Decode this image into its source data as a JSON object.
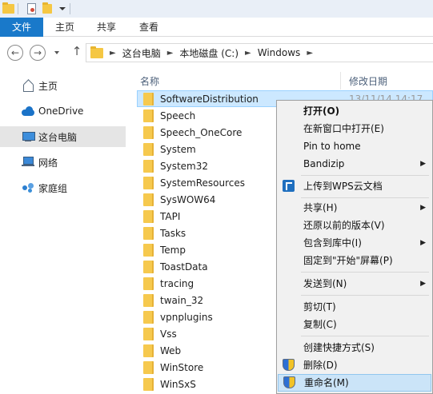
{
  "ribbon": {
    "tabs": [
      "文件",
      "主页",
      "共享",
      "查看"
    ]
  },
  "address": {
    "crumbs": [
      "这台电脑",
      "本地磁盘 (C:)",
      "Windows"
    ]
  },
  "nav": {
    "items": [
      {
        "label": "主页",
        "icon": "home-icon"
      },
      {
        "label": "OneDrive",
        "icon": "onedrive-icon"
      },
      {
        "label": "这台电脑",
        "icon": "this-pc-icon"
      },
      {
        "label": "网络",
        "icon": "network-icon"
      },
      {
        "label": "家庭组",
        "icon": "homegroup-icon"
      }
    ]
  },
  "columns": {
    "name": "名称",
    "date": "修改日期"
  },
  "files": [
    {
      "name": "SoftwareDistribution",
      "date": "13/11/14 14:17"
    },
    {
      "name": "Speech"
    },
    {
      "name": "Speech_OneCore"
    },
    {
      "name": "System"
    },
    {
      "name": "System32"
    },
    {
      "name": "SystemResources"
    },
    {
      "name": "SysWOW64"
    },
    {
      "name": "TAPI"
    },
    {
      "name": "Tasks"
    },
    {
      "name": "Temp"
    },
    {
      "name": "ToastData"
    },
    {
      "name": "tracing"
    },
    {
      "name": "twain_32"
    },
    {
      "name": "vpnplugins"
    },
    {
      "name": "Vss"
    },
    {
      "name": "Web"
    },
    {
      "name": "WinStore"
    },
    {
      "name": "WinSxS"
    }
  ],
  "context_menu": {
    "items": [
      {
        "label": "打开(O)",
        "bold": true
      },
      {
        "label": "在新窗口中打开(E)"
      },
      {
        "label": "Pin to home"
      },
      {
        "label": "Bandizip",
        "submenu": true
      },
      {
        "label": "上传到WPS云文档",
        "icon": "wps-cloud-icon"
      },
      {
        "label": "共享(H)",
        "submenu": true
      },
      {
        "label": "还原以前的版本(V)"
      },
      {
        "label": "包含到库中(I)",
        "submenu": true
      },
      {
        "label": "固定到\"开始\"屏幕(P)"
      },
      {
        "label": "发送到(N)",
        "submenu": true
      },
      {
        "label": "剪切(T)"
      },
      {
        "label": "复制(C)"
      },
      {
        "label": "创建快捷方式(S)"
      },
      {
        "label": "删除(D)",
        "icon": "uac-shield-icon"
      },
      {
        "label": "重命名(M)",
        "icon": "uac-shield-icon",
        "highlighted": true
      }
    ]
  },
  "colors": {
    "file_tab": "#1979ca",
    "selection": "#cce8ff",
    "menu_hover": "#cbe4f8",
    "folder": "#f6c94e"
  }
}
